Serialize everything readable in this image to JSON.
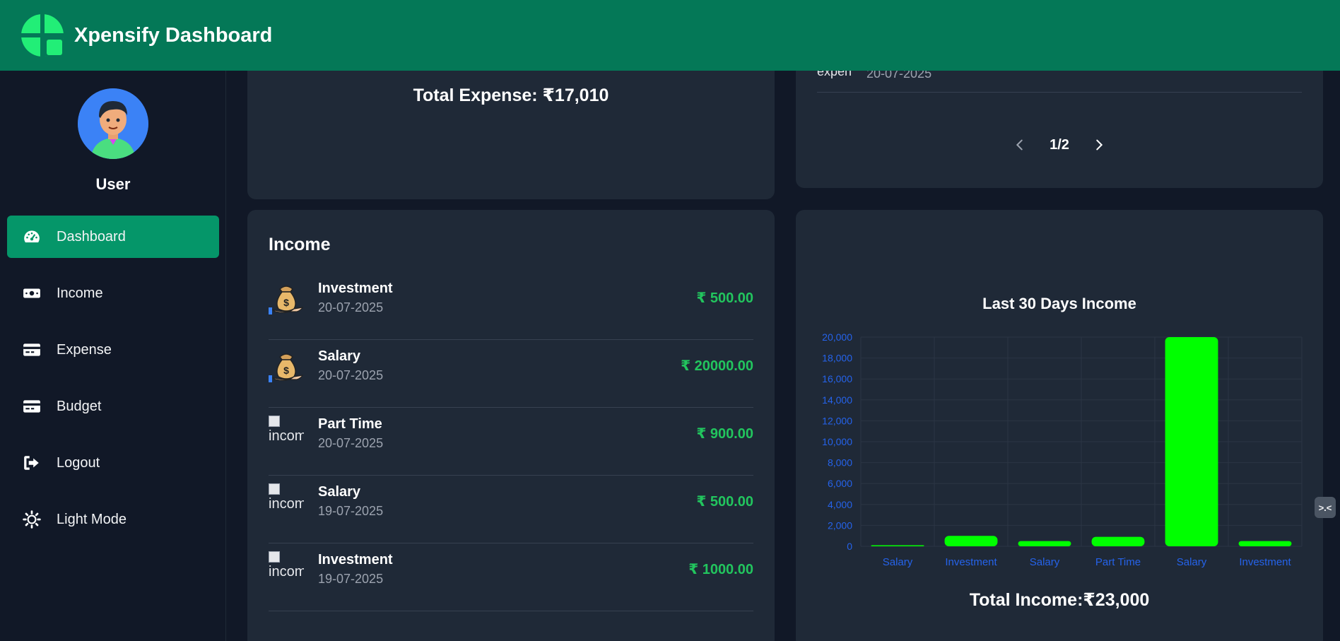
{
  "header": {
    "title": "Xpensify Dashboard"
  },
  "sidebar": {
    "user_name": "User",
    "items": [
      {
        "label": "Dashboard",
        "icon": "gauge-icon",
        "active": true
      },
      {
        "label": "Income",
        "icon": "money-bill-icon",
        "active": false
      },
      {
        "label": "Expense",
        "icon": "credit-card-icon",
        "active": false
      },
      {
        "label": "Budget",
        "icon": "credit-card-icon",
        "active": false
      },
      {
        "label": "Logout",
        "icon": "logout-icon",
        "active": false
      },
      {
        "label": "Light Mode",
        "icon": "sun-icon",
        "active": false
      }
    ]
  },
  "expense_summary": {
    "total_label": "Total Expense: ₹17,010"
  },
  "expense_list": {
    "partial_item": {
      "icon_alt": "expen",
      "date": "20-07-2025"
    },
    "pagination": {
      "current": "1/2"
    }
  },
  "income": {
    "title": "Income",
    "items": [
      {
        "name": "Investment",
        "date": "20-07-2025",
        "amount": "₹ 500.00",
        "icon": "money-bag-icon",
        "broken": false,
        "alt": ""
      },
      {
        "name": "Salary",
        "date": "20-07-2025",
        "amount": "₹ 20000.00",
        "icon": "money-bag-icon",
        "broken": false,
        "alt": ""
      },
      {
        "name": "Part Time",
        "date": "20-07-2025",
        "amount": "₹ 900.00",
        "icon": "broken-image-icon",
        "broken": true,
        "alt": "incom"
      },
      {
        "name": "Salary",
        "date": "19-07-2025",
        "amount": "₹ 500.00",
        "icon": "broken-image-icon",
        "broken": true,
        "alt": "incom"
      },
      {
        "name": "Investment",
        "date": "19-07-2025",
        "amount": "₹ 1000.00",
        "icon": "broken-image-icon",
        "broken": true,
        "alt": "incom"
      }
    ]
  },
  "chart_data": {
    "type": "bar",
    "title": "Last 30 Days Income",
    "categories": [
      "Salary",
      "Investment",
      "Salary",
      "Part Time",
      "Salary",
      "Investment"
    ],
    "values": [
      100,
      1000,
      500,
      900,
      20000,
      500
    ],
    "ylim": [
      0,
      20000
    ],
    "yticks": [
      "0",
      "2,000",
      "4,000",
      "6,000",
      "8,000",
      "10,000",
      "12,000",
      "14,000",
      "16,000",
      "18,000",
      "20,000"
    ],
    "grid": true,
    "bar_color": "#00ff00",
    "tick_color": "#2563eb"
  },
  "income_summary": {
    "total_label": "Total Income:₹23,000"
  },
  "colors": {
    "header": "#047857",
    "active_nav": "#059669",
    "card": "#1f2937",
    "background": "#111827",
    "amount": "#22c55e"
  }
}
